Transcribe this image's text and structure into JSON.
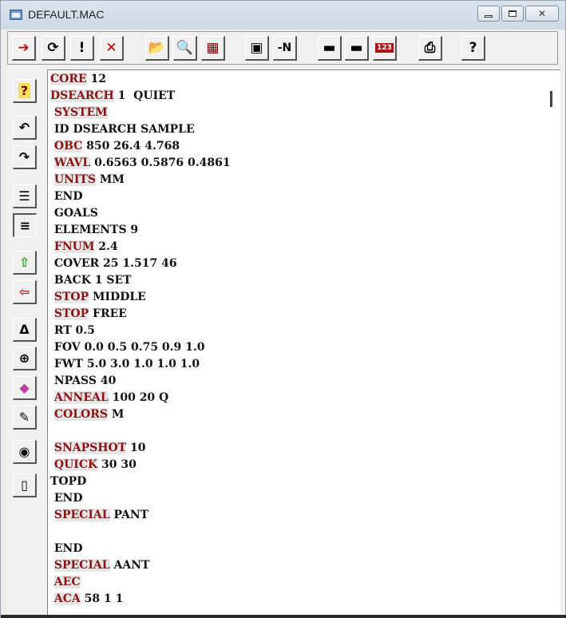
{
  "window": {
    "title": "DEFAULT.MAC"
  },
  "top_toolbar": [
    {
      "name": "run-macro-button",
      "icon": "run-arrow-icon",
      "glyph": "➔"
    },
    {
      "name": "refresh-button",
      "icon": "refresh-icon",
      "glyph": "⟳"
    },
    {
      "name": "exclaim-button",
      "icon": "exclamation-icon",
      "glyph": "!"
    },
    {
      "name": "stop-button",
      "icon": "stop-icon",
      "glyph": "✕"
    },
    {
      "name": "open-file-button",
      "icon": "folder-open-icon",
      "glyph": "📂"
    },
    {
      "name": "find-button",
      "icon": "magnifier-icon",
      "glyph": "🔍"
    },
    {
      "name": "tools-button",
      "icon": "tools-icon",
      "glyph": "▦"
    },
    {
      "name": "edit-button",
      "icon": "edit-icon",
      "glyph": "▣"
    },
    {
      "name": "renumber-button",
      "icon": "renumber-icon",
      "glyph": "-N"
    },
    {
      "name": "save-button",
      "icon": "floppy-icon",
      "glyph": "▬"
    },
    {
      "name": "save-as-button",
      "icon": "floppy-plus-icon",
      "glyph": "▬"
    },
    {
      "name": "line-numbers-button",
      "icon": "numbers-icon",
      "glyph": "123"
    },
    {
      "name": "print-button",
      "icon": "printer-icon",
      "glyph": "⎙"
    },
    {
      "name": "help-button",
      "icon": "question-icon",
      "glyph": "?"
    }
  ],
  "left_toolbar": [
    {
      "name": "help-button-left",
      "icon": "question-box-icon",
      "glyph": "?"
    },
    {
      "name": "undo-button",
      "icon": "undo-icon",
      "glyph": "↶"
    },
    {
      "name": "redo-button",
      "icon": "redo-icon",
      "glyph": "↷"
    },
    {
      "name": "indent-button",
      "icon": "indent-icon",
      "glyph": "☰"
    },
    {
      "name": "align-button",
      "icon": "lines-icon",
      "glyph": "≡"
    },
    {
      "name": "move-up-button",
      "icon": "arrow-up-icon",
      "glyph": "⇧"
    },
    {
      "name": "move-left-button",
      "icon": "arrow-left-icon",
      "glyph": "⇦"
    },
    {
      "name": "delta-button",
      "icon": "delta-icon",
      "glyph": "Δ"
    },
    {
      "name": "target-button",
      "icon": "target-icon",
      "glyph": "⊕"
    },
    {
      "name": "gem-button",
      "icon": "gem-icon",
      "glyph": "◆"
    },
    {
      "name": "pen-button",
      "icon": "pen-icon",
      "glyph": "✎"
    },
    {
      "name": "view-button",
      "icon": "eye-icon",
      "glyph": "◉"
    },
    {
      "name": "exit-button",
      "icon": "door-icon",
      "glyph": "▯"
    }
  ],
  "editor": {
    "lines": [
      {
        "kw": "CORE",
        "rest": " 12"
      },
      {
        "kw": "DSEARCH",
        "rest": " 1  QUIET"
      },
      {
        "kw": " SYSTEM",
        "rest": ""
      },
      {
        "kw": "",
        "rest": " ID DSEARCH SAMPLE"
      },
      {
        "kw": " OBC",
        "rest": " 850 26.4 4.768"
      },
      {
        "kw": " WAVL",
        "rest": " 0.6563 0.5876 0.4861"
      },
      {
        "kw": " UNITS",
        "rest": " MM"
      },
      {
        "kw": "",
        "rest": " END"
      },
      {
        "kw": "",
        "rest": " GOALS"
      },
      {
        "kw": "",
        "rest": " ELEMENTS 9"
      },
      {
        "kw": " FNUM",
        "rest": " 2.4"
      },
      {
        "kw": "",
        "rest": " COVER 25 1.517 46"
      },
      {
        "kw": "",
        "rest": " BACK 1 SET"
      },
      {
        "kw": " STOP",
        "rest": " MIDDLE"
      },
      {
        "kw": " STOP",
        "rest": " FREE"
      },
      {
        "kw": "",
        "rest": " RT 0.5"
      },
      {
        "kw": "",
        "rest": " FOV 0.0 0.5 0.75 0.9 1.0"
      },
      {
        "kw": "",
        "rest": " FWT 5.0 3.0 1.0 1.0 1.0"
      },
      {
        "kw": "",
        "rest": " NPASS 40"
      },
      {
        "kw": " ANNEAL",
        "rest": " 100 20 Q"
      },
      {
        "kw": " COLORS",
        "rest": " M"
      },
      {
        "kw": "",
        "rest": ""
      },
      {
        "kw": " SNAPSHOT",
        "rest": " 10"
      },
      {
        "kw": " QUICK",
        "rest": " 30 30"
      },
      {
        "kw": "",
        "rest": "TOPD"
      },
      {
        "kw": "",
        "rest": " END"
      },
      {
        "kw": " SPECIAL",
        "rest": " PANT"
      },
      {
        "kw": "",
        "rest": ""
      },
      {
        "kw": "",
        "rest": " END"
      },
      {
        "kw": " SPECIAL",
        "rest": " AANT"
      },
      {
        "kw": " AEC",
        "rest": ""
      },
      {
        "kw": " ACA",
        "rest": " 58 1 1"
      }
    ]
  },
  "colors": {
    "keyword": "#8b1414",
    "keyword_bg": "#e6e6e6"
  }
}
